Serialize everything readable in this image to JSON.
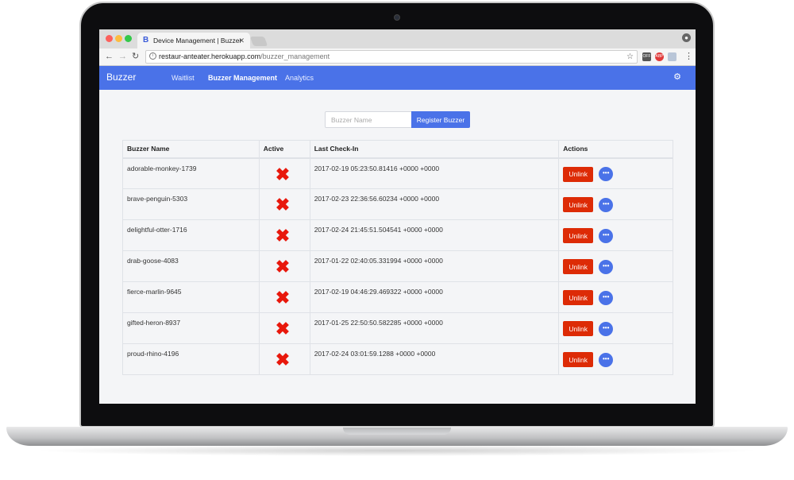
{
  "browser": {
    "tab_title": "Device Management | Buzzer",
    "tab_favicon": "B",
    "url_host": "restaur-anteater.herokuapp.com",
    "url_path": "/buzzer_management"
  },
  "extensions": {
    "off_label": "OFF",
    "abp_label": "ABP"
  },
  "navbar": {
    "brand": "Buzzer",
    "links": [
      "Waitlist",
      "Buzzer Management",
      "Analytics"
    ]
  },
  "register": {
    "placeholder": "Buzzer Name",
    "button_label": "Register Buzzer"
  },
  "table": {
    "headers": [
      "Buzzer Name",
      "Active",
      "Last Check-In",
      "Actions"
    ],
    "unlink_label": "Unlink",
    "more_label": "•••",
    "rows": [
      {
        "name": "adorable-monkey-1739",
        "active": false,
        "last_checkin": "2017-02-19 05:23:50.81416 +0000 +0000"
      },
      {
        "name": "brave-penguin-5303",
        "active": false,
        "last_checkin": "2017-02-23 22:36:56.60234 +0000 +0000"
      },
      {
        "name": "delightful-otter-1716",
        "active": false,
        "last_checkin": "2017-02-24 21:45:51.504541 +0000 +0000"
      },
      {
        "name": "drab-goose-4083",
        "active": false,
        "last_checkin": "2017-01-22 02:40:05.331994 +0000 +0000"
      },
      {
        "name": "fierce-marlin-9645",
        "active": false,
        "last_checkin": "2017-02-19 04:46:29.469322 +0000 +0000"
      },
      {
        "name": "gifted-heron-8937",
        "active": false,
        "last_checkin": "2017-01-25 22:50:50.582285 +0000 +0000"
      },
      {
        "name": "proud-rhino-4196",
        "active": false,
        "last_checkin": "2017-02-24 03:01:59.1288 +0000 +0000"
      }
    ]
  },
  "colors": {
    "accent": "#4a72e8",
    "danger": "#dd2b06",
    "inactive_mark": "#e8180c"
  }
}
